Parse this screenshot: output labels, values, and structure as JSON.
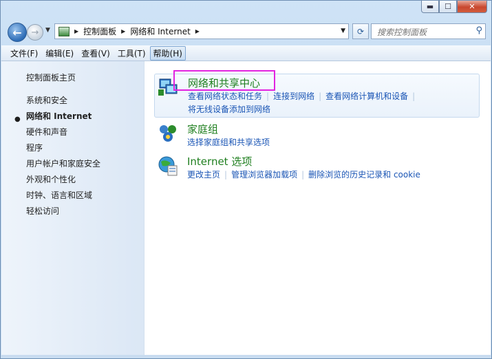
{
  "caption": {
    "minimize": "▬",
    "maximize": "☐",
    "close": "✕"
  },
  "address": {
    "crumbs": [
      "控制面板",
      "网络和 Internet"
    ],
    "search_placeholder": "搜索控制面板"
  },
  "menu": [
    {
      "label": "文件(F)"
    },
    {
      "label": "编辑(E)"
    },
    {
      "label": "查看(V)"
    },
    {
      "label": "工具(T)"
    },
    {
      "label": "帮助(H)",
      "active": true
    }
  ],
  "sidebar": {
    "items": [
      {
        "label": "控制面板主页"
      },
      {
        "label": "系统和安全"
      },
      {
        "label": "网络和 Internet",
        "current": true
      },
      {
        "label": "硬件和声音"
      },
      {
        "label": "程序"
      },
      {
        "label": "用户帐户和家庭安全"
      },
      {
        "label": "外观和个性化"
      },
      {
        "label": "时钟、语言和区域"
      },
      {
        "label": "轻松访问"
      }
    ]
  },
  "groups": [
    {
      "title": "网络和共享中心",
      "icon": "network-sharing-icon",
      "links_row1": [
        "查看网络状态和任务",
        "连接到网络",
        "查看网络计算机和设备"
      ],
      "links_row2": [
        "将无线设备添加到网络"
      ]
    },
    {
      "title": "家庭组",
      "icon": "homegroup-icon",
      "links_row1": [
        "选择家庭组和共享选项"
      ]
    },
    {
      "title": "Internet 选项",
      "icon": "internet-options-icon",
      "links_row1": [
        "更改主页",
        "管理浏览器加载项",
        "删除浏览的历史记录和 cookie"
      ]
    }
  ],
  "colors": {
    "highlight_box": "#e223e0",
    "link": "#1a55b5",
    "title": "#1f7f1f"
  }
}
